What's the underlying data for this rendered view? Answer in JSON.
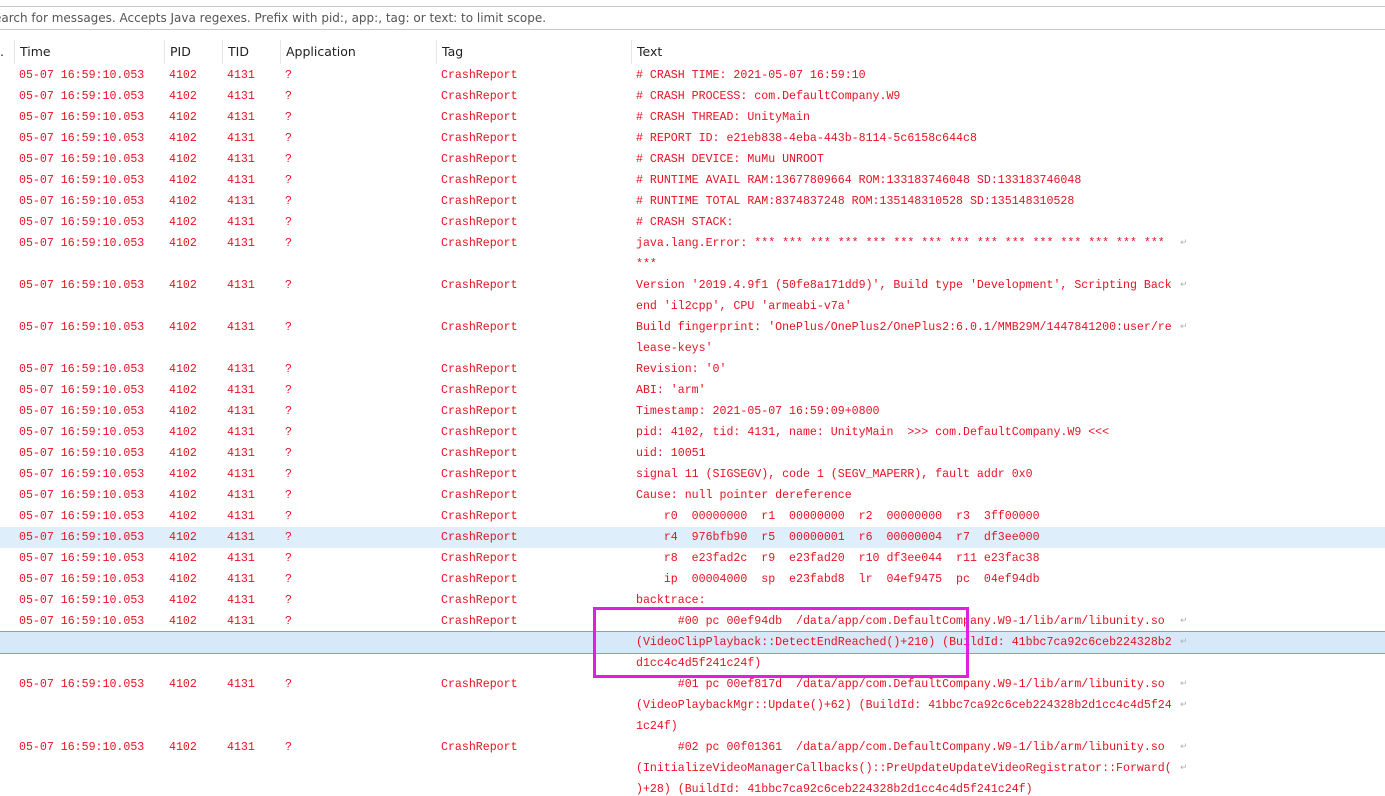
{
  "search": {
    "placeholder": "earch for messages. Accepts Java regexes. Prefix with pid:, app:, tag: or text: to limit scope."
  },
  "columns": {
    "level": ".",
    "time": "Time",
    "pid": "PID",
    "tid": "TID",
    "application": "Application",
    "tag": "Tag",
    "text": "Text"
  },
  "colors": {
    "log_text": "#e81123",
    "selection": "#dfeefb",
    "focus_border": "#7da2ce",
    "annotation": "#e020e0"
  },
  "wrap_icon": "line-wrap-icon",
  "log": [
    {
      "time": "05-07 16:59:10.053",
      "pid": "4102",
      "tid": "4131",
      "app": "?",
      "tag": "CrashReport",
      "text": [
        "# CRASH TIME: 2021-05-07 16:59:10"
      ]
    },
    {
      "time": "05-07 16:59:10.053",
      "pid": "4102",
      "tid": "4131",
      "app": "?",
      "tag": "CrashReport",
      "text": [
        "# CRASH PROCESS: com.DefaultCompany.W9"
      ]
    },
    {
      "time": "05-07 16:59:10.053",
      "pid": "4102",
      "tid": "4131",
      "app": "?",
      "tag": "CrashReport",
      "text": [
        "# CRASH THREAD: UnityMain"
      ]
    },
    {
      "time": "05-07 16:59:10.053",
      "pid": "4102",
      "tid": "4131",
      "app": "?",
      "tag": "CrashReport",
      "text": [
        "# REPORT ID: e21eb838-4eba-443b-8114-5c6158c644c8"
      ]
    },
    {
      "time": "05-07 16:59:10.053",
      "pid": "4102",
      "tid": "4131",
      "app": "?",
      "tag": "CrashReport",
      "text": [
        "# CRASH DEVICE: MuMu UNROOT"
      ]
    },
    {
      "time": "05-07 16:59:10.053",
      "pid": "4102",
      "tid": "4131",
      "app": "?",
      "tag": "CrashReport",
      "text": [
        "# RUNTIME AVAIL RAM:13677809664 ROM:133183746048 SD:133183746048"
      ]
    },
    {
      "time": "05-07 16:59:10.053",
      "pid": "4102",
      "tid": "4131",
      "app": "?",
      "tag": "CrashReport",
      "text": [
        "# RUNTIME TOTAL RAM:8374837248 ROM:135148310528 SD:135148310528"
      ]
    },
    {
      "time": "05-07 16:59:10.053",
      "pid": "4102",
      "tid": "4131",
      "app": "?",
      "tag": "CrashReport",
      "text": [
        "# CRASH STACK:"
      ]
    },
    {
      "time": "05-07 16:59:10.053",
      "pid": "4102",
      "tid": "4131",
      "app": "?",
      "tag": "CrashReport",
      "text": [
        "java.lang.Error: *** *** *** *** *** *** *** *** *** *** *** *** *** *** ***",
        "***"
      ]
    },
    {
      "time": "05-07 16:59:10.053",
      "pid": "4102",
      "tid": "4131",
      "app": "?",
      "tag": "CrashReport",
      "text": [
        "Version '2019.4.9f1 (50fe8a171dd9)', Build type 'Development', Scripting Back",
        "end 'il2cpp', CPU 'armeabi-v7a'"
      ]
    },
    {
      "time": "05-07 16:59:10.053",
      "pid": "4102",
      "tid": "4131",
      "app": "?",
      "tag": "CrashReport",
      "text": [
        "Build fingerprint: 'OnePlus/OnePlus2/OnePlus2:6.0.1/MMB29M/1447841200:user/re",
        "lease-keys'"
      ]
    },
    {
      "time": "05-07 16:59:10.053",
      "pid": "4102",
      "tid": "4131",
      "app": "?",
      "tag": "CrashReport",
      "text": [
        "Revision: '0'"
      ]
    },
    {
      "time": "05-07 16:59:10.053",
      "pid": "4102",
      "tid": "4131",
      "app": "?",
      "tag": "CrashReport",
      "text": [
        "ABI: 'arm'"
      ]
    },
    {
      "time": "05-07 16:59:10.053",
      "pid": "4102",
      "tid": "4131",
      "app": "?",
      "tag": "CrashReport",
      "text": [
        "Timestamp: 2021-05-07 16:59:09+0800"
      ]
    },
    {
      "time": "05-07 16:59:10.053",
      "pid": "4102",
      "tid": "4131",
      "app": "?",
      "tag": "CrashReport",
      "text": [
        "pid: 4102, tid: 4131, name: UnityMain  >>> com.DefaultCompany.W9 <<<"
      ]
    },
    {
      "time": "05-07 16:59:10.053",
      "pid": "4102",
      "tid": "4131",
      "app": "?",
      "tag": "CrashReport",
      "text": [
        "uid: 10051"
      ]
    },
    {
      "time": "05-07 16:59:10.053",
      "pid": "4102",
      "tid": "4131",
      "app": "?",
      "tag": "CrashReport",
      "text": [
        "signal 11 (SIGSEGV), code 1 (SEGV_MAPERR), fault addr 0x0"
      ]
    },
    {
      "time": "05-07 16:59:10.053",
      "pid": "4102",
      "tid": "4131",
      "app": "?",
      "tag": "CrashReport",
      "text": [
        "Cause: null pointer dereference"
      ]
    },
    {
      "time": "05-07 16:59:10.053",
      "pid": "4102",
      "tid": "4131",
      "app": "?",
      "tag": "CrashReport",
      "text": [
        "    r0  00000000  r1  00000000  r2  00000000  r3  3ff00000"
      ]
    },
    {
      "time": "05-07 16:59:10.053",
      "pid": "4102",
      "tid": "4131",
      "app": "?",
      "tag": "CrashReport",
      "text": [
        "    r4  976bfb90  r5  00000001  r6  00000004  r7  df3ee000"
      ],
      "selected": true
    },
    {
      "time": "05-07 16:59:10.053",
      "pid": "4102",
      "tid": "4131",
      "app": "?",
      "tag": "CrashReport",
      "text": [
        "    r8  e23fad2c  r9  e23fad20  r10 df3ee044  r11 e23fac38"
      ]
    },
    {
      "time": "05-07 16:59:10.053",
      "pid": "4102",
      "tid": "4131",
      "app": "?",
      "tag": "CrashReport",
      "text": [
        "    ip  00004000  sp  e23fabd8  lr  04ef9475  pc  04ef94db"
      ]
    },
    {
      "time": "05-07 16:59:10.053",
      "pid": "4102",
      "tid": "4131",
      "app": "?",
      "tag": "CrashReport",
      "text": [
        "backtrace:"
      ]
    },
    {
      "time": "05-07 16:59:10.053",
      "pid": "4102",
      "tid": "4131",
      "app": "?",
      "tag": "CrashReport",
      "text": [
        "      #00 pc 00ef94db  /data/app/com.DefaultCompany.W9-1/lib/arm/libunity.so ",
        "(VideoClipPlayback::DetectEndReached()+210) (BuildId: 41bbc7ca92c6ceb224328b2",
        "d1cc4c4d5f241c24f)"
      ],
      "focused_line": 1
    },
    {
      "time": "05-07 16:59:10.053",
      "pid": "4102",
      "tid": "4131",
      "app": "?",
      "tag": "CrashReport",
      "text": [
        "      #01 pc 00ef817d  /data/app/com.DefaultCompany.W9-1/lib/arm/libunity.so ",
        "(VideoPlaybackMgr::Update()+62) (BuildId: 41bbc7ca92c6ceb224328b2d1cc4c4d5f24",
        "1c24f)"
      ]
    },
    {
      "time": "05-07 16:59:10.053",
      "pid": "4102",
      "tid": "4131",
      "app": "?",
      "tag": "CrashReport",
      "text": [
        "      #02 pc 00f01361  /data/app/com.DefaultCompany.W9-1/lib/arm/libunity.so ",
        "(InitializeVideoManagerCallbacks()::PreUpdateUpdateVideoRegistrator::Forward(",
        ")+28) (BuildId: 41bbc7ca92c6ceb224328b2d1cc4c4d5f241c24f)"
      ]
    }
  ]
}
